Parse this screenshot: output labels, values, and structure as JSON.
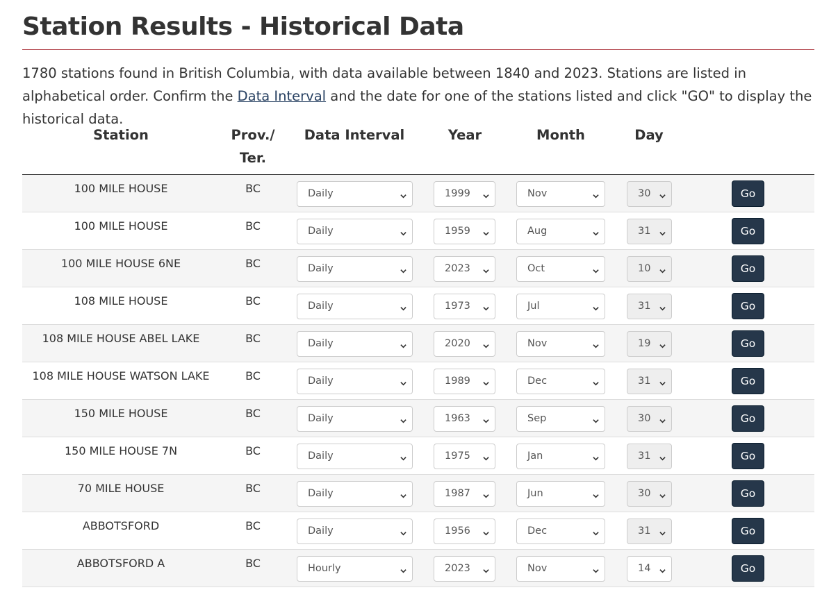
{
  "page": {
    "title": "Station Results - Historical Data",
    "intro_before": "1780 stations found in British Columbia, with data available between 1840 and 2023. Stations are listed in alphabetical order. Confirm the ",
    "intro_link": "Data Interval",
    "intro_after": " and the date for one of the stations listed and click \"GO\" to display the historical data."
  },
  "table": {
    "headers": {
      "station": "Station",
      "prov_line1": "Prov./",
      "prov_line2": "Ter.",
      "interval": "Data Interval",
      "year": "Year",
      "month": "Month",
      "day": "Day"
    },
    "go_label": "Go",
    "rows": [
      {
        "station": "100 MILE HOUSE",
        "prov": "BC",
        "interval": "Daily",
        "year": "1999",
        "month": "Nov",
        "day": "30",
        "day_disabled": true
      },
      {
        "station": "100 MILE HOUSE",
        "prov": "BC",
        "interval": "Daily",
        "year": "1959",
        "month": "Aug",
        "day": "31",
        "day_disabled": true
      },
      {
        "station": "100 MILE HOUSE 6NE",
        "prov": "BC",
        "interval": "Daily",
        "year": "2023",
        "month": "Oct",
        "day": "10",
        "day_disabled": true
      },
      {
        "station": "108 MILE HOUSE",
        "prov": "BC",
        "interval": "Daily",
        "year": "1973",
        "month": "Jul",
        "day": "31",
        "day_disabled": true
      },
      {
        "station": "108 MILE HOUSE ABEL LAKE",
        "prov": "BC",
        "interval": "Daily",
        "year": "2020",
        "month": "Nov",
        "day": "19",
        "day_disabled": true
      },
      {
        "station": "108 MILE HOUSE WATSON LAKE",
        "prov": "BC",
        "interval": "Daily",
        "year": "1989",
        "month": "Dec",
        "day": "31",
        "day_disabled": true
      },
      {
        "station": "150 MILE HOUSE",
        "prov": "BC",
        "interval": "Daily",
        "year": "1963",
        "month": "Sep",
        "day": "30",
        "day_disabled": true
      },
      {
        "station": "150 MILE HOUSE 7N",
        "prov": "BC",
        "interval": "Daily",
        "year": "1975",
        "month": "Jan",
        "day": "31",
        "day_disabled": true
      },
      {
        "station": "70 MILE HOUSE",
        "prov": "BC",
        "interval": "Daily",
        "year": "1987",
        "month": "Jun",
        "day": "30",
        "day_disabled": true
      },
      {
        "station": "ABBOTSFORD",
        "prov": "BC",
        "interval": "Daily",
        "year": "1956",
        "month": "Dec",
        "day": "31",
        "day_disabled": true
      },
      {
        "station": "ABBOTSFORD A",
        "prov": "BC",
        "interval": "Hourly",
        "year": "2023",
        "month": "Nov",
        "day": "14",
        "day_disabled": false
      }
    ]
  }
}
